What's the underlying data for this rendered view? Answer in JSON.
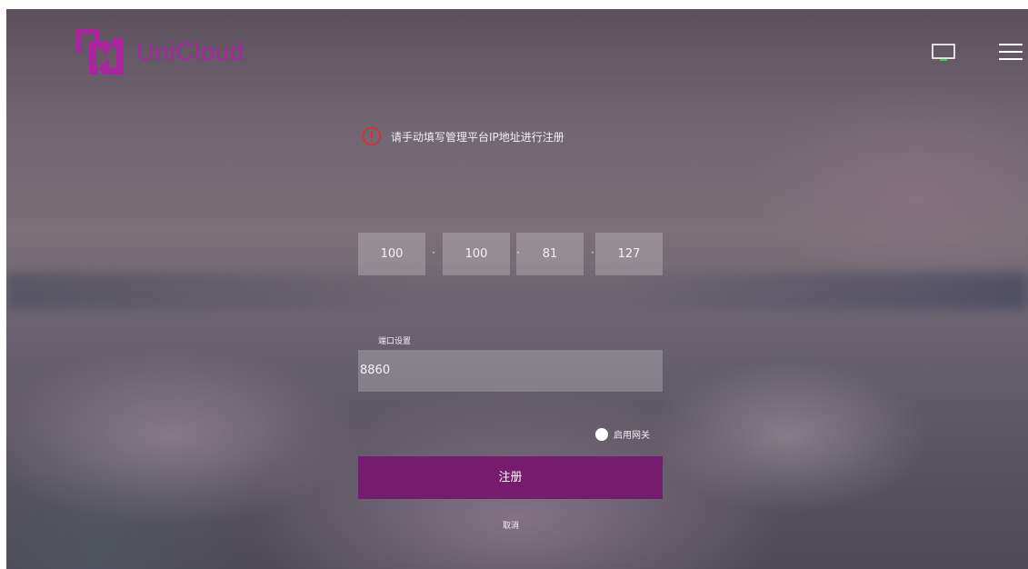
{
  "brand": {
    "name": "UniCloud",
    "accent": "#a8259e"
  },
  "header": {
    "icons": [
      "monitor-icon",
      "menu-icon"
    ]
  },
  "notice": {
    "icon": "alert-circle-icon",
    "icon_color": "#e8262b",
    "text": "请手动填写管理平台IP地址进行注册"
  },
  "ip": {
    "octets": [
      "100",
      "100",
      "81",
      "127"
    ],
    "separator": "·"
  },
  "port": {
    "label": "端口设置",
    "value": "8860"
  },
  "gateway": {
    "label": "启用网关",
    "enabled": false
  },
  "actions": {
    "register_label": "注册",
    "register_color": "#751c6f",
    "cancel_label": "取消"
  }
}
